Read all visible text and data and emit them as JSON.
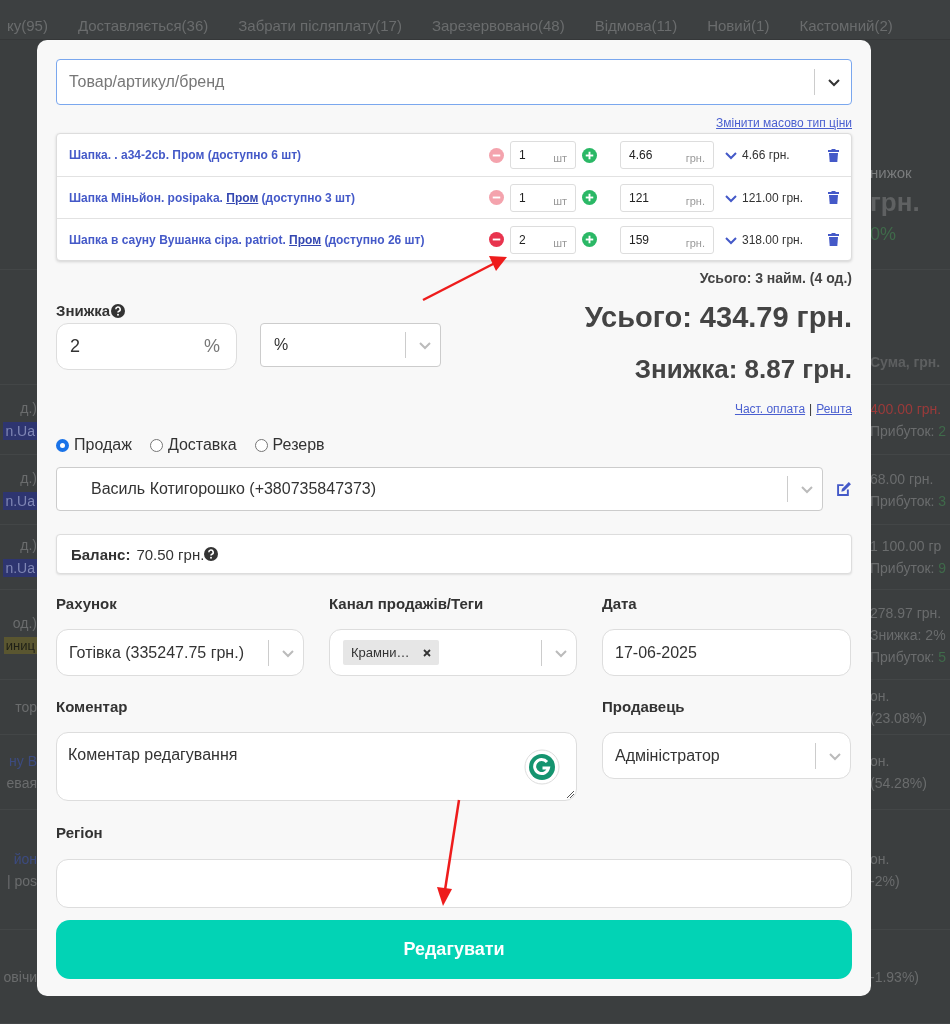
{
  "background": {
    "tabs": [
      {
        "label": "ку(95)"
      },
      {
        "label": "Доставляється(36)"
      },
      {
        "label": "Забрати післяплату(17)"
      },
      {
        "label": "Зарезервовано(48)"
      },
      {
        "label": "Відмова(11)"
      },
      {
        "label": "Новий(1)"
      },
      {
        "label": "Кастомний(2)"
      }
    ],
    "rows": [
      {
        "left": [],
        "right": []
      },
      {
        "left": [],
        "right": [
          {
            "kind": "muted",
            "text": "нижок"
          },
          {
            "kind": "big",
            "text": "грн."
          },
          {
            "kind": "green",
            "text": "0%"
          }
        ]
      },
      {
        "left": [],
        "right": []
      },
      {
        "left": [],
        "right": [
          {
            "kind": "header",
            "text": "Сума, грн."
          }
        ]
      },
      {
        "left": [
          {
            "kind": "text",
            "text": "д.)"
          },
          {
            "kind": "badge",
            "text": "n.Ua"
          }
        ],
        "right": [
          {
            "kind": "red",
            "text": "400.00 грн."
          },
          {
            "kind": "profit",
            "text": "Прибуток:",
            "value": "2"
          }
        ]
      },
      {
        "left": [
          {
            "kind": "text",
            "text": "д.)"
          },
          {
            "kind": "badge",
            "text": "n.Ua"
          }
        ],
        "right": [
          {
            "kind": "text",
            "text": "68.00 грн."
          },
          {
            "kind": "profit",
            "text": "Прибуток:",
            "value": "3"
          }
        ]
      },
      {
        "left": [
          {
            "kind": "text",
            "text": "д.)"
          },
          {
            "kind": "badge",
            "text": "n.Ua"
          }
        ],
        "right": [
          {
            "kind": "text",
            "text": "1 100.00 гр"
          },
          {
            "kind": "profit",
            "text": "Прибуток:",
            "value": "9"
          }
        ]
      },
      {
        "left": [
          {
            "kind": "text",
            "text": "од.)"
          },
          {
            "kind": "tag",
            "text": "иниц"
          }
        ],
        "right": [
          {
            "kind": "text",
            "text": "278.97 грн."
          },
          {
            "kind": "text",
            "text": "Знижка: 2%"
          },
          {
            "kind": "profit",
            "text": "Прибуток:",
            "value": "5"
          }
        ]
      },
      {
        "left": [
          {
            "kind": "text",
            "text": "тор"
          }
        ],
        "right": [
          {
            "kind": "text",
            "text": "он."
          },
          {
            "kind": "text",
            "text": "(23.08%)"
          }
        ]
      },
      {
        "left": [
          {
            "kind": "link",
            "text": "ну В"
          },
          {
            "kind": "text",
            "text": "евая"
          }
        ],
        "right": [
          {
            "kind": "text",
            "text": "он."
          },
          {
            "kind": "text",
            "text": "(54.28%)"
          }
        ]
      },
      {
        "left": [
          {
            "kind": "link",
            "text": "йон"
          },
          {
            "kind": "text",
            "text": "| pos"
          }
        ],
        "right": [
          {
            "kind": "text",
            "text": "он."
          },
          {
            "kind": "text",
            "text": "-2%)"
          }
        ]
      },
      {
        "left": [
          {
            "kind": "text",
            "text": "овічи"
          }
        ],
        "right": [
          {
            "kind": "text",
            "text": "-1.93%)"
          }
        ]
      }
    ]
  },
  "modal": {
    "product_search": {
      "placeholder": "Товар/артикул/бренд"
    },
    "mass_price_link": "Змінити масово тип ціни",
    "items": [
      {
        "name": "Шапка. . а34-2cb.",
        "price_type": "Пром",
        "price_type_link": false,
        "availability": "(доступно 6 шт)",
        "can_decrease": false,
        "quantity": "1",
        "unit": "шт",
        "price": "4.66",
        "currency": "грн.",
        "total": "4.66 грн."
      },
      {
        "name": "Шапка Міньйон. posipaka.",
        "price_type": "Пром",
        "price_type_link": true,
        "availability": "(доступно 3 шт)",
        "can_decrease": false,
        "quantity": "1",
        "unit": "шт",
        "price": "121",
        "currency": "грн.",
        "total": "121.00 грн."
      },
      {
        "name": "Шапка в сауну Вушанка cipa. patriot.",
        "price_type": "Пром",
        "price_type_link": true,
        "availability": "(доступно 26 шт)",
        "can_decrease": true,
        "quantity": "2",
        "unit": "шт",
        "price": "159",
        "currency": "грн.",
        "total": "318.00 грн."
      }
    ],
    "items_summary": "Усього: 3 найм. (4 од.)",
    "discount": {
      "label": "Знижка",
      "value": "2",
      "unit": "%",
      "type": "%"
    },
    "total": "Усього: 434.79 грн.",
    "discount_total": "Знижка: 8.87 грн.",
    "payment_links": [
      "Част. оплата",
      "Решта"
    ],
    "link_separator": "|",
    "order_types": [
      {
        "label": "Продаж",
        "selected": true
      },
      {
        "label": "Доставка",
        "selected": false
      },
      {
        "label": "Резерв",
        "selected": false
      }
    ],
    "customer": "Василь Котигорошко (+380735847373)",
    "balance": {
      "label": "Баланс:",
      "value": "70.50 грн."
    },
    "account": {
      "label": "Рахунок",
      "value": "Готівка (335247.75 грн.)"
    },
    "channel": {
      "label": "Канал продажів/Теги",
      "tags": [
        "Крамни…"
      ]
    },
    "date": {
      "label": "Дата",
      "value": "17-06-2025"
    },
    "comment": {
      "label": "Коментар",
      "value": "Коментар редагування"
    },
    "seller": {
      "label": "Продавець",
      "value": "Адміністратор"
    },
    "region": {
      "label": "Регіон"
    },
    "submit": "Редагувати"
  }
}
